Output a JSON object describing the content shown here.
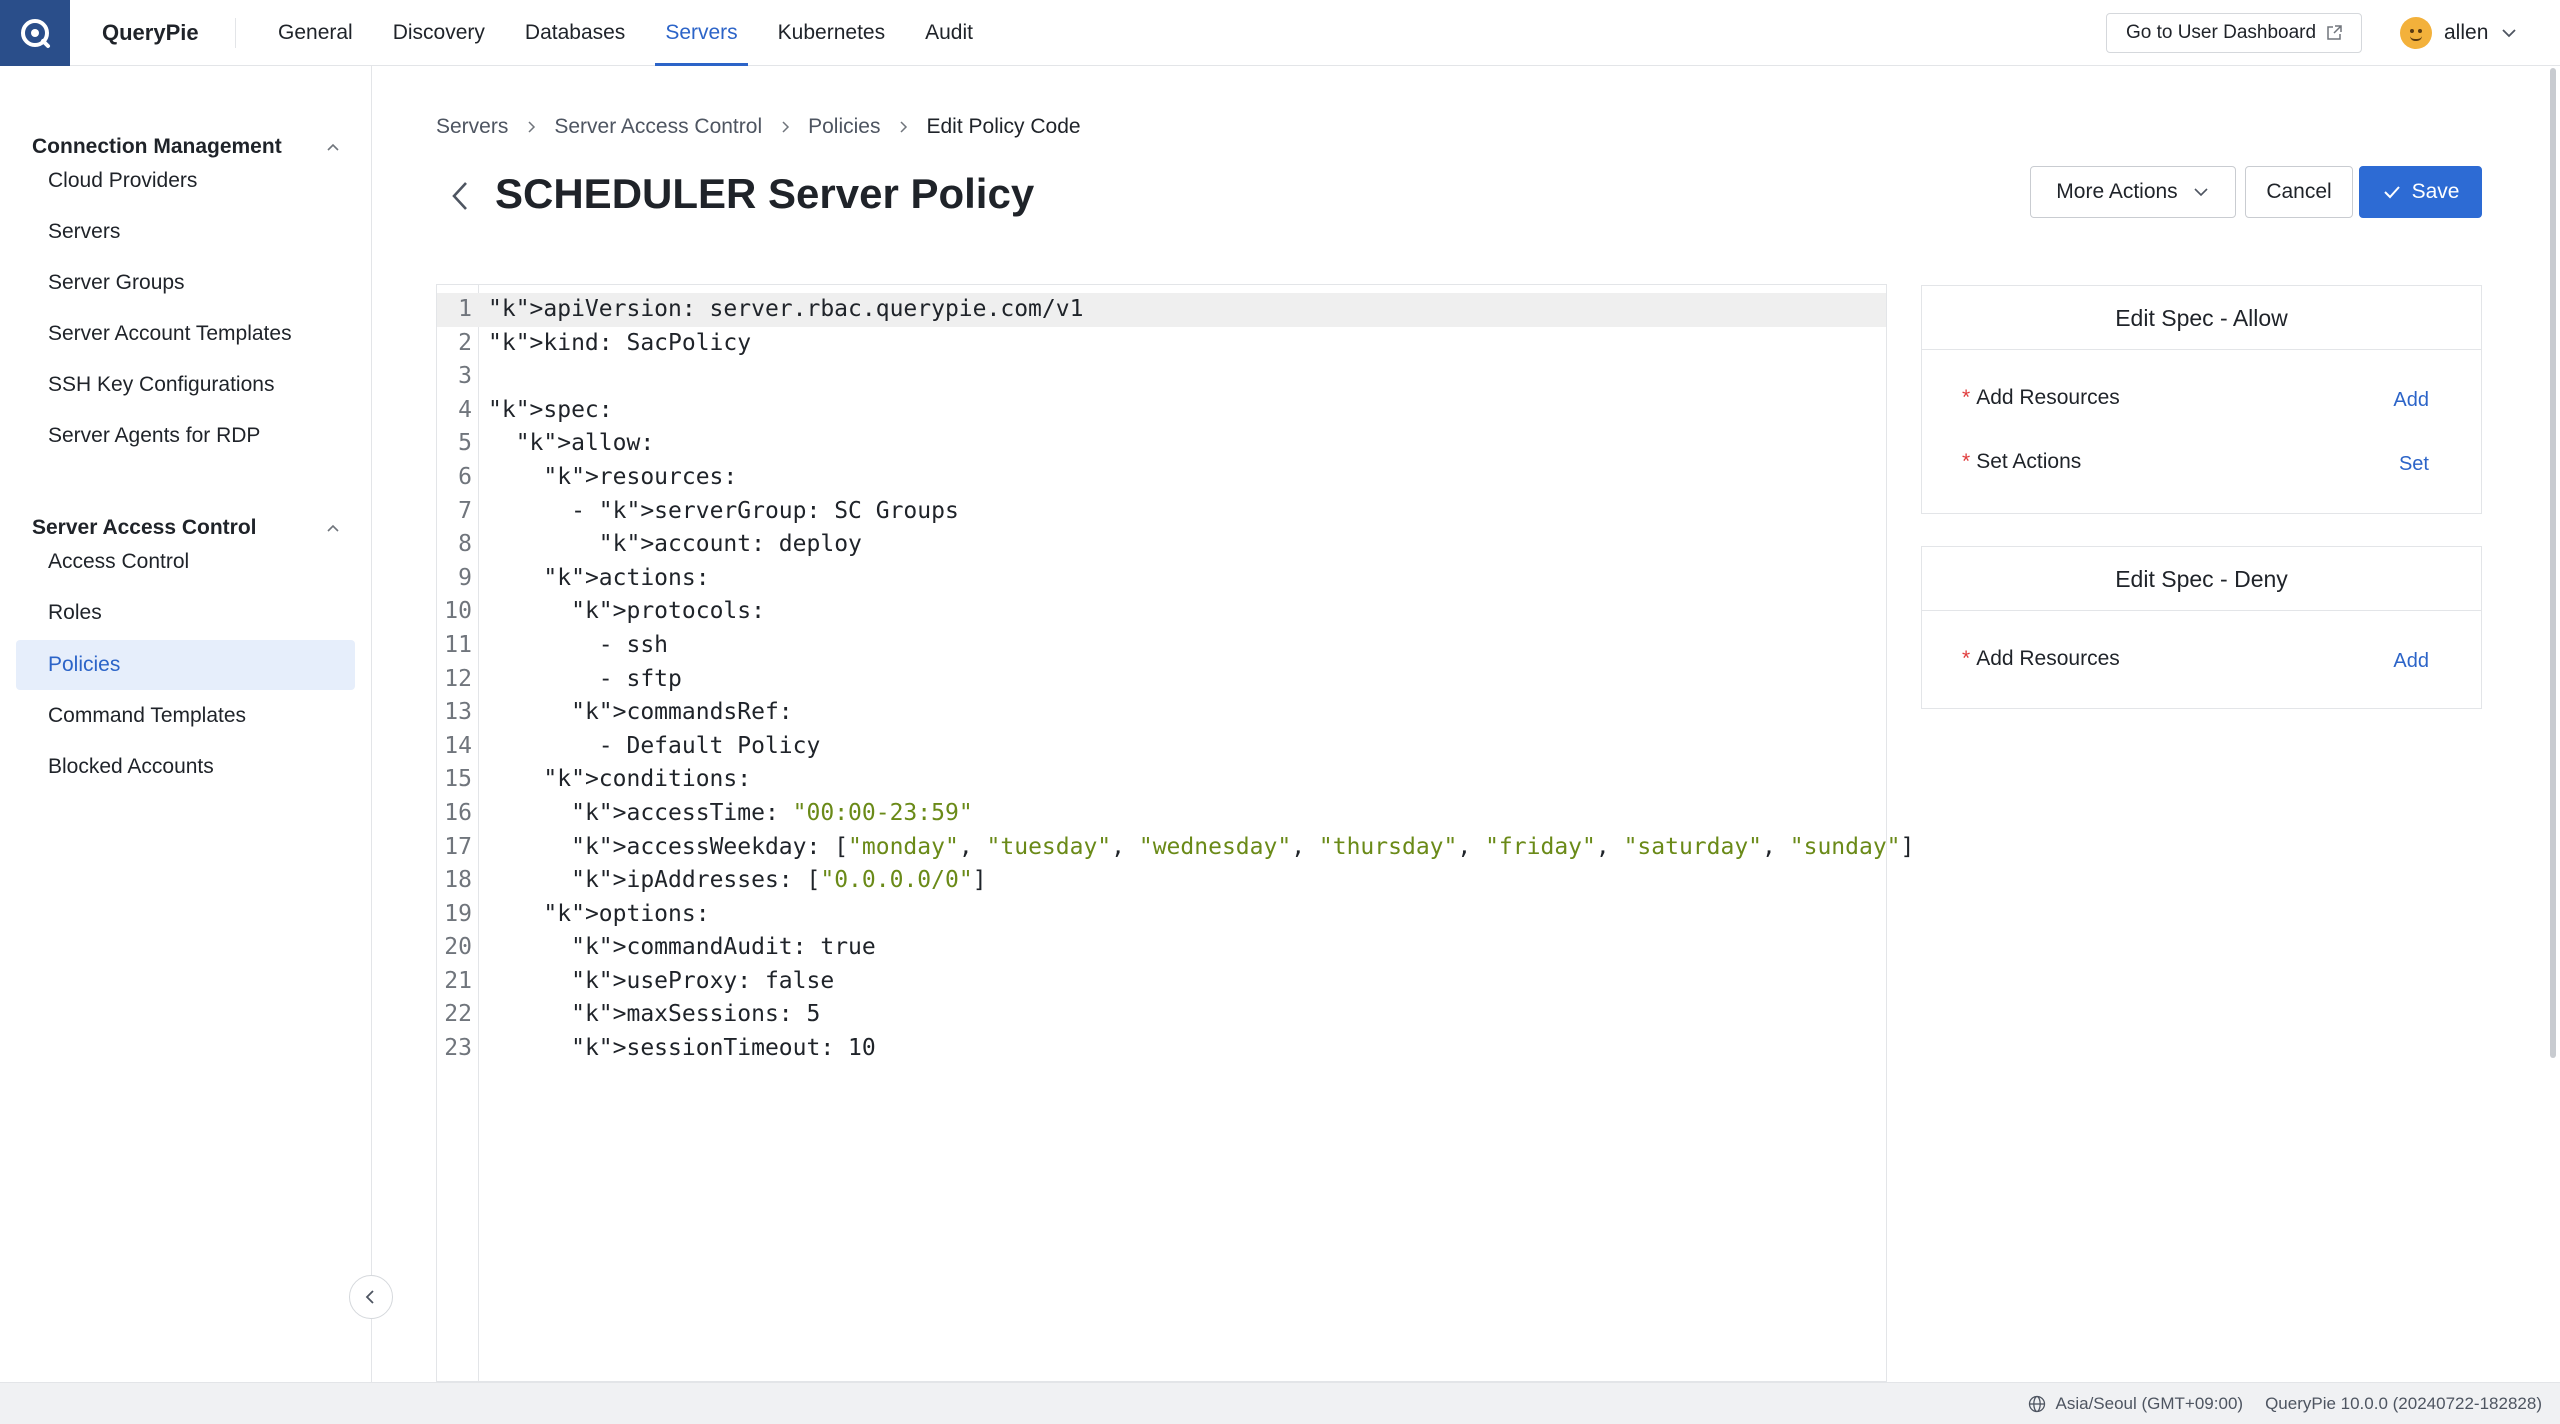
{
  "app": {
    "name": "QueryPie"
  },
  "nav": {
    "tabs": [
      {
        "label": "General"
      },
      {
        "label": "Discovery"
      },
      {
        "label": "Databases"
      },
      {
        "label": "Servers",
        "active": true
      },
      {
        "label": "Kubernetes"
      },
      {
        "label": "Audit"
      }
    ],
    "user_dashboard_label": "Go to User Dashboard",
    "username": "allen"
  },
  "sidebar": {
    "groups": [
      {
        "title": "Connection Management",
        "items": [
          "Cloud Providers",
          "Servers",
          "Server Groups",
          "Server Account Templates",
          "SSH Key Configurations",
          "Server Agents for RDP"
        ]
      },
      {
        "title": "Server Access Control",
        "items": [
          "Access Control",
          "Roles",
          "Policies",
          "Command Templates",
          "Blocked Accounts"
        ],
        "active_item": "Policies"
      }
    ]
  },
  "breadcrumb": [
    "Servers",
    "Server Access Control",
    "Policies",
    "Edit Policy Code"
  ],
  "page": {
    "title": "SCHEDULER Server Policy",
    "more_actions_label": "More Actions",
    "cancel_label": "Cancel",
    "save_label": "Save"
  },
  "editor": {
    "active_line": 1,
    "lines": [
      "apiVersion: server.rbac.querypie.com/v1",
      "kind: SacPolicy",
      "",
      "spec:",
      "  allow:",
      "    resources:",
      "      - serverGroup: SC Groups",
      "        account: deploy",
      "    actions:",
      "      protocols:",
      "        - ssh",
      "        - sftp",
      "      commandsRef:",
      "        - Default Policy",
      "    conditions:",
      "      accessTime: \"00:00-23:59\"",
      "      accessWeekday: [\"monday\", \"tuesday\", \"wednesday\", \"thursday\", \"friday\", \"saturday\", \"sunday\"]",
      "      ipAddresses: [\"0.0.0.0/0\"]",
      "    options:",
      "      commandAudit: true",
      "      useProxy: false",
      "      maxSessions: 5",
      "      sessionTimeout: 10"
    ]
  },
  "spec_allow": {
    "title": "Edit Spec - Allow",
    "rows": [
      {
        "label": "Add Resources",
        "action": "Add"
      },
      {
        "label": "Set Actions",
        "action": "Set"
      }
    ]
  },
  "spec_deny": {
    "title": "Edit Spec - Deny",
    "rows": [
      {
        "label": "Add Resources",
        "action": "Add"
      }
    ]
  },
  "status": {
    "timezone": "Asia/Seoul (GMT+09:00)",
    "version": "QueryPie 10.0.0 (20240722-182828)"
  },
  "colors": {
    "accent": "#2c64c8",
    "logo_bg": "#2a4e8a",
    "save_bg": "#2d6bd4",
    "key": "#2f6aa6",
    "string": "#6a8a18",
    "required": "#e03c3c"
  }
}
